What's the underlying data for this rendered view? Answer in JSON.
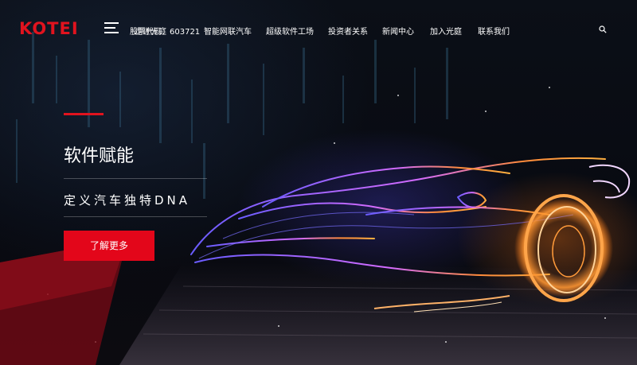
{
  "brand": {
    "logo_text": "KOTEI",
    "accent_color": "#e1131e"
  },
  "header": {
    "stock_text": "股票代码：603721",
    "stock_overlay_text": "走进光庭",
    "nav_items": [
      {
        "label": "智能网联汽车"
      },
      {
        "label": "超级软件工场"
      },
      {
        "label": "投资者关系"
      },
      {
        "label": "新闻中心"
      },
      {
        "label": "加入光庭"
      },
      {
        "label": "联系我们"
      }
    ],
    "search_icon": "search-icon",
    "menu_icon": "hamburger-menu-icon"
  },
  "hero": {
    "title": "软件赋能",
    "subtitle": "定义汽车独特DNA",
    "button_label": "了解更多",
    "button_color": "#e3061a"
  }
}
